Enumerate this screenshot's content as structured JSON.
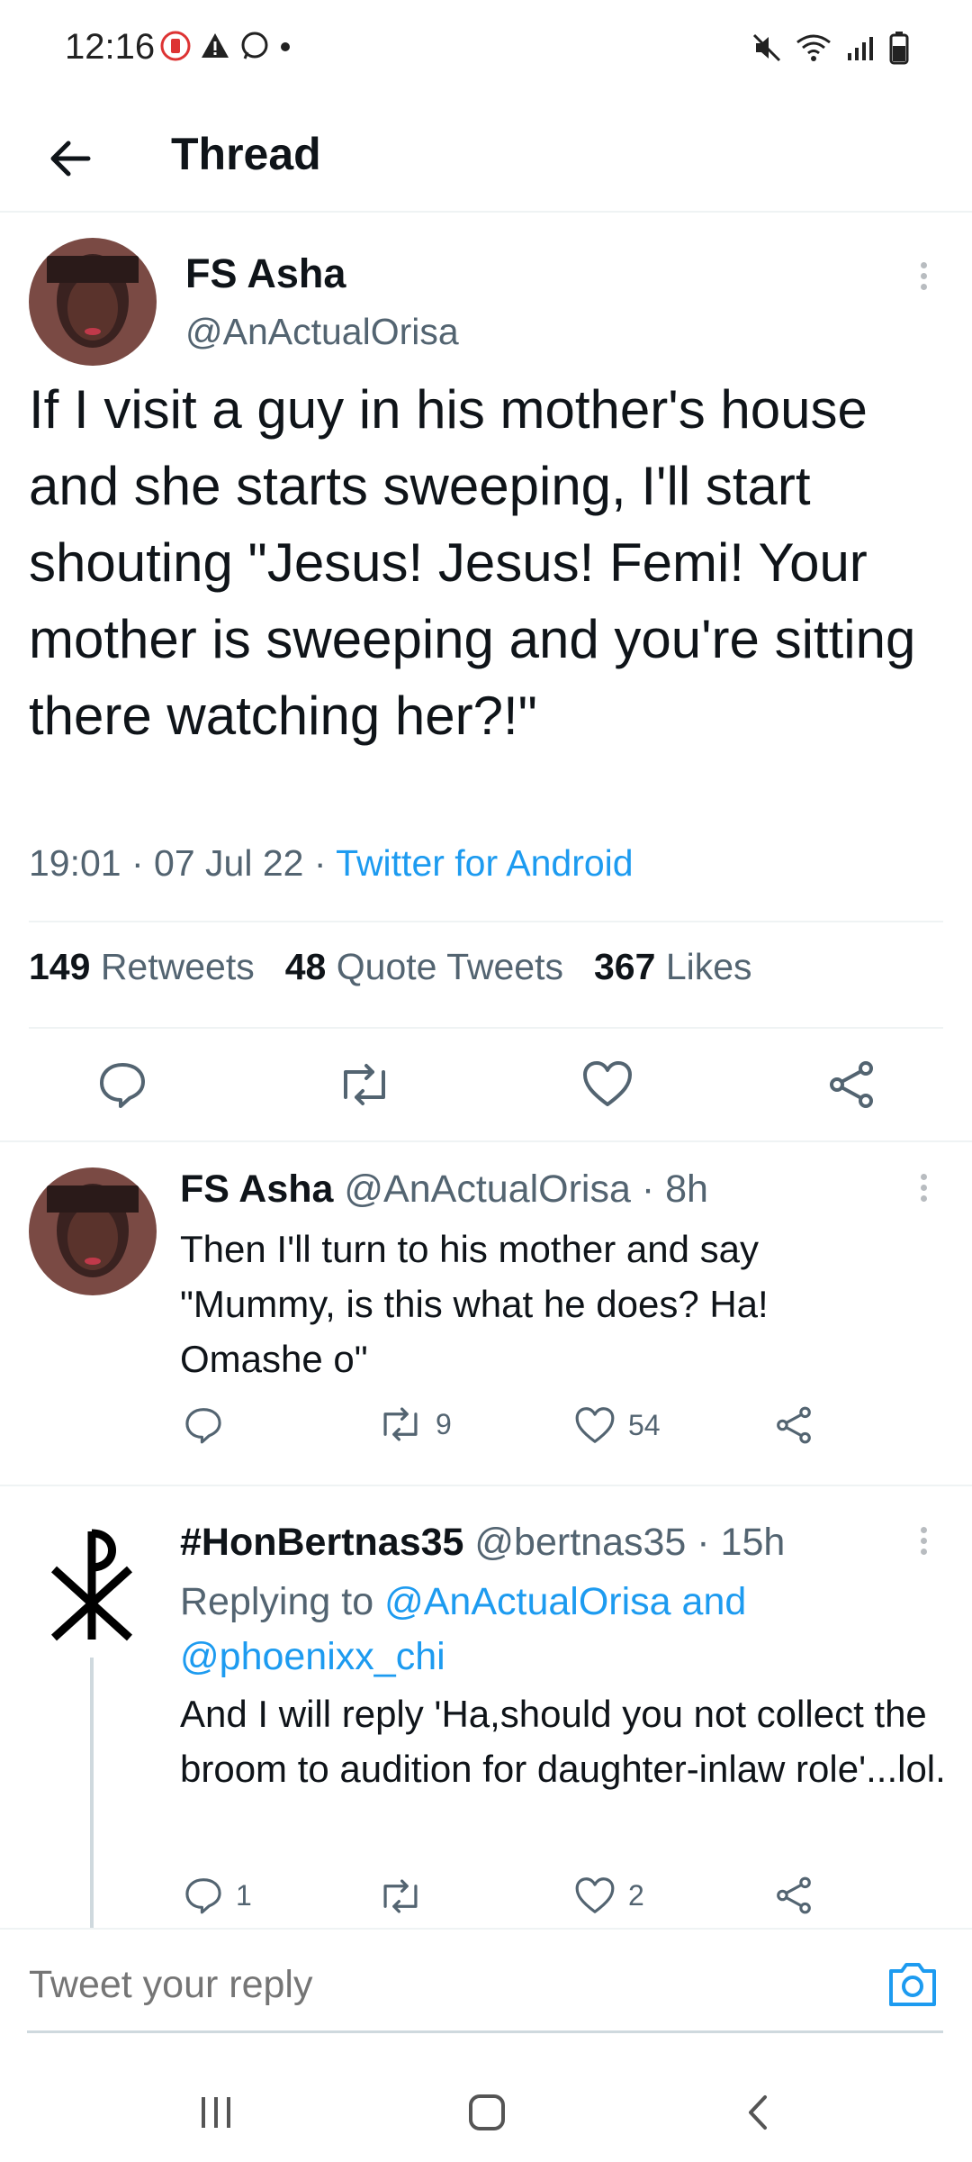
{
  "status_bar": {
    "time": "12:16"
  },
  "header": {
    "title": "Thread"
  },
  "main_tweet": {
    "name": "FS Asha",
    "handle": "@AnActualOrisa",
    "text": "If I visit a guy in his mother's house and she starts sweeping, I'll start shouting \"Jesus! Jesus! Femi! Your mother is sweeping and you're sitting there watching her?!\"",
    "time": "19:01",
    "date": "07 Jul 22",
    "source": "Twitter for Android",
    "retweets_count": "149",
    "retweets_label": "Retweets",
    "quotes_count": "48",
    "quotes_label": "Quote Tweets",
    "likes_count": "367",
    "likes_label": "Likes"
  },
  "reply1": {
    "name": "FS Asha",
    "handle": "@AnActualOrisa",
    "age": "8h",
    "text": "Then I'll turn to his mother and say \"Mummy, is this what he does? Ha! Omashe o\"",
    "retweets": "9",
    "likes": "54"
  },
  "reply2": {
    "name": "#HonBertnas35",
    "handle": "@bertnas35",
    "age": "15h",
    "replying_prefix": "Replying to",
    "replying_to1": "@AnActualOrisa",
    "replying_and": "and",
    "replying_to2": "@phoenixx_chi",
    "text": "And I will reply 'Ha,should you not collect the broom to audition for daughter-inlaw role'...lol.",
    "replies": "1",
    "likes": "2"
  },
  "composer": {
    "placeholder": "Tweet your reply"
  },
  "colors": {
    "accent": "#1d9bf0",
    "text": "#0f1419",
    "secondary": "#536471"
  }
}
